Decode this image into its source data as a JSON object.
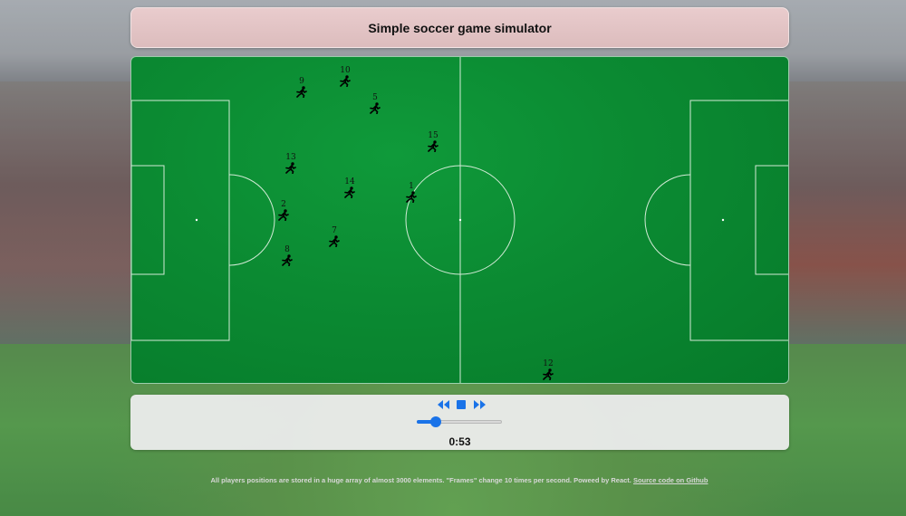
{
  "app": {
    "title": "Simple soccer game simulator"
  },
  "players": [
    {
      "number": "9"
    },
    {
      "number": "10"
    },
    {
      "number": "5"
    },
    {
      "number": "15"
    },
    {
      "number": "13"
    },
    {
      "number": "14"
    },
    {
      "number": "1"
    },
    {
      "number": "2"
    },
    {
      "number": "7"
    },
    {
      "number": "8"
    },
    {
      "number": "12"
    }
  ],
  "controls": {
    "rewind_icon": "rewind-icon",
    "stop_icon": "stop-icon",
    "forward_icon": "fast-forward-icon",
    "progress_percent": 22,
    "time": "0:53"
  },
  "footer": {
    "text": "All players positions are stored in a huge array of almost 3000 elements. \"Frames\" change 10 times per second. Poweed by React.",
    "link": "Source code on Github"
  },
  "colors": {
    "accent": "#1a73e8",
    "pitch": "#0b8a32",
    "title_bar": "#e4c6c7"
  }
}
